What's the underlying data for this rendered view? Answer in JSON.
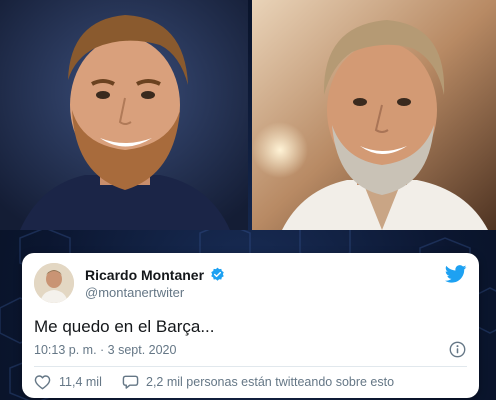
{
  "images": {
    "left_photo": "photo-smiling-bearded-man",
    "right_photo": "photo-smiling-grey-haired-man"
  },
  "tweet": {
    "author_name": "Ricardo Montaner",
    "handle": "@montanertwiter",
    "verified": true,
    "text": "Me quedo en el Barça...",
    "timestamp": "10:13 p. m. · 3 sept. 2020",
    "likes": "11,4 mil",
    "conversation": "2,2 mil personas están twitteando sobre esto"
  },
  "icons": {
    "verified": "verified-badge-icon",
    "twitter": "twitter-bird-icon",
    "info": "info-icon",
    "like": "heart-icon",
    "reply": "speech-bubble-icon"
  },
  "colors": {
    "twitter_blue": "#1da1f2",
    "text_primary": "#14171a",
    "text_secondary": "#657786",
    "background": "#0d1a33"
  }
}
